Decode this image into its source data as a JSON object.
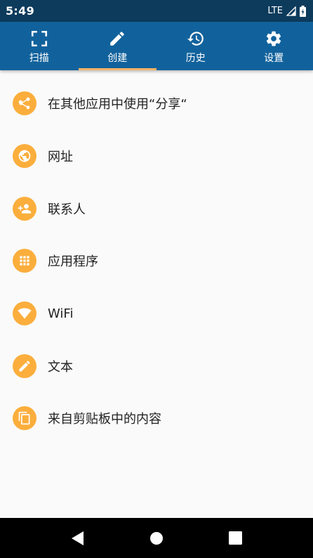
{
  "status_bar": {
    "time": "5:49",
    "network": "LTE"
  },
  "tabs": [
    {
      "label": "扫描",
      "icon": "scan-frame-icon",
      "active": false
    },
    {
      "label": "创建",
      "icon": "pencil-icon",
      "active": true
    },
    {
      "label": "历史",
      "icon": "history-icon",
      "active": false
    },
    {
      "label": "设置",
      "icon": "gear-icon",
      "active": false
    }
  ],
  "items": [
    {
      "label": "在其他应用中使用“分享“",
      "icon": "share-icon"
    },
    {
      "label": "网址",
      "icon": "globe-icon"
    },
    {
      "label": "联系人",
      "icon": "add-contact-icon"
    },
    {
      "label": "应用程序",
      "icon": "apps-grid-icon"
    },
    {
      "label": "WiFi",
      "icon": "wifi-icon"
    },
    {
      "label": "文本",
      "icon": "pencil-icon"
    },
    {
      "label": "来自剪贴板中的内容",
      "icon": "copy-icon"
    }
  ],
  "colors": {
    "status_bar": "#0d3b5c",
    "toolbar": "#11629c",
    "tab_indicator": "#f5b366",
    "item_icon_bg": "#fbae3c",
    "nav_bar": "#000000"
  }
}
